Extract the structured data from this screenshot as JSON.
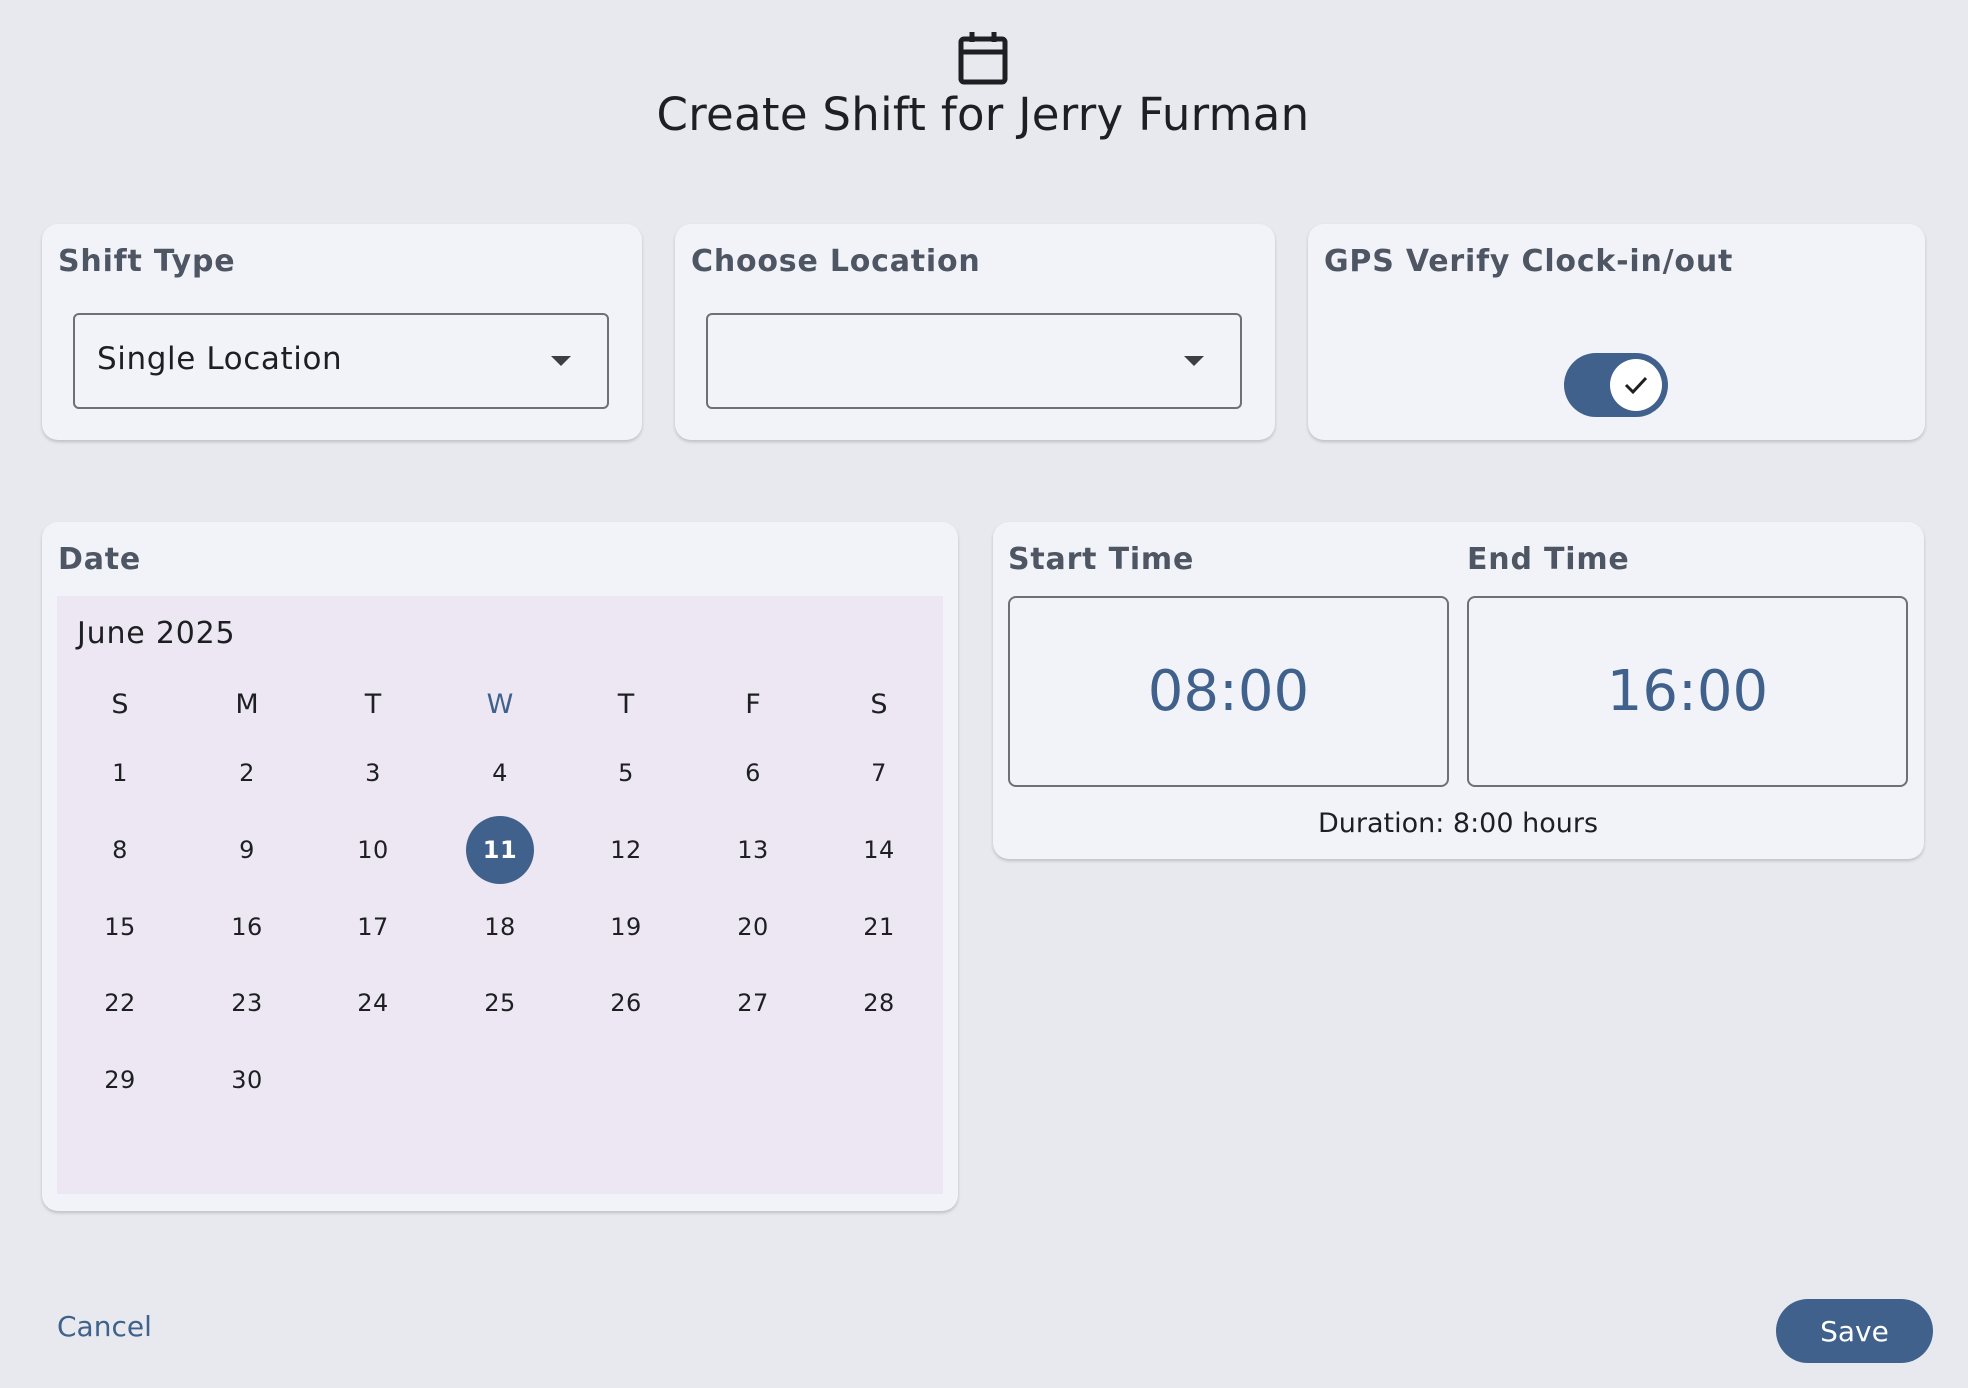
{
  "header": {
    "icon": "calendar-icon",
    "title": "Create Shift for Jerry Furman"
  },
  "shift_type": {
    "label": "Shift Type",
    "value": "Single Location"
  },
  "location": {
    "label": "Choose Location",
    "value": ""
  },
  "gps": {
    "label": "GPS Verify Clock-in/out",
    "enabled": true
  },
  "date": {
    "label": "Date",
    "month_label": "June 2025",
    "weekdays": [
      "S",
      "M",
      "T",
      "W",
      "T",
      "F",
      "S"
    ],
    "current_weekday_index": 3,
    "selected_day": 11,
    "weeks": [
      [
        "1",
        "2",
        "3",
        "4",
        "5",
        "6",
        "7"
      ],
      [
        "8",
        "9",
        "10",
        "11",
        "12",
        "13",
        "14"
      ],
      [
        "15",
        "16",
        "17",
        "18",
        "19",
        "20",
        "21"
      ],
      [
        "22",
        "23",
        "24",
        "25",
        "26",
        "27",
        "28"
      ],
      [
        "29",
        "30",
        "",
        "",
        "",
        "",
        ""
      ]
    ]
  },
  "time": {
    "start_label": "Start Time",
    "start_value": "08:00",
    "end_label": "End Time",
    "end_value": "16:00",
    "duration": "Duration: 8:00 hours"
  },
  "actions": {
    "cancel_label": "Cancel",
    "save_label": "Save"
  },
  "colors": {
    "accent": "#3f618c",
    "background": "#e7e9ee",
    "card": "#f2f3f9",
    "calendar_bg": "#ece7f2"
  }
}
